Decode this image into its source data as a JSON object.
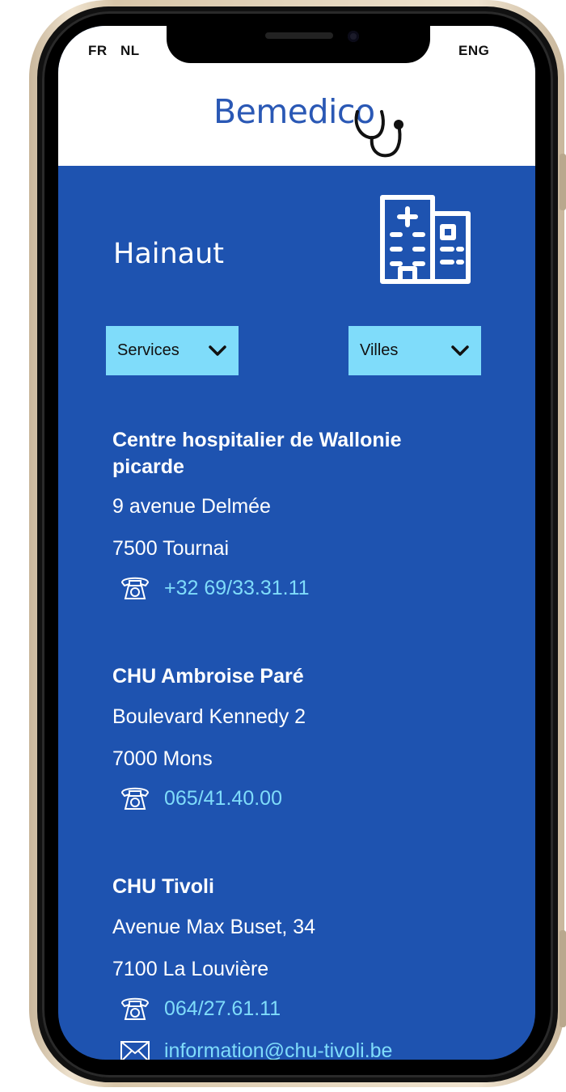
{
  "status": {
    "lang_fr": "FR",
    "lang_nl": "NL",
    "lang_en": "ENG"
  },
  "brand": {
    "logo": "Bemedico"
  },
  "page": {
    "region": "Hainaut"
  },
  "filters": {
    "services_label": "Services",
    "villes_label": "Villes"
  },
  "hospitals": [
    {
      "name": "Centre hospitalier de Wallonie picarde",
      "address": "9 avenue Delmée",
      "city": "7500 Tournai",
      "phone": "+32 69/33.31.11"
    },
    {
      "name": "CHU Ambroise Paré",
      "address": "Boulevard Kennedy 2",
      "city": "7000 Mons",
      "phone": "065/41.40.00"
    },
    {
      "name": "CHU Tivoli",
      "address": "Avenue Max Buset, 34",
      "city": "7100 La Louvière",
      "phone": "064/27.61.11",
      "email": "information@chu-tivoli.be"
    }
  ],
  "colors": {
    "background": "#1e53b0",
    "accent": "#7fdcfa",
    "logo": "#2a58b5"
  },
  "icons": [
    "stethoscope-icon",
    "hospital-building-icon",
    "chevron-down-icon",
    "telephone-icon",
    "mail-icon"
  ]
}
